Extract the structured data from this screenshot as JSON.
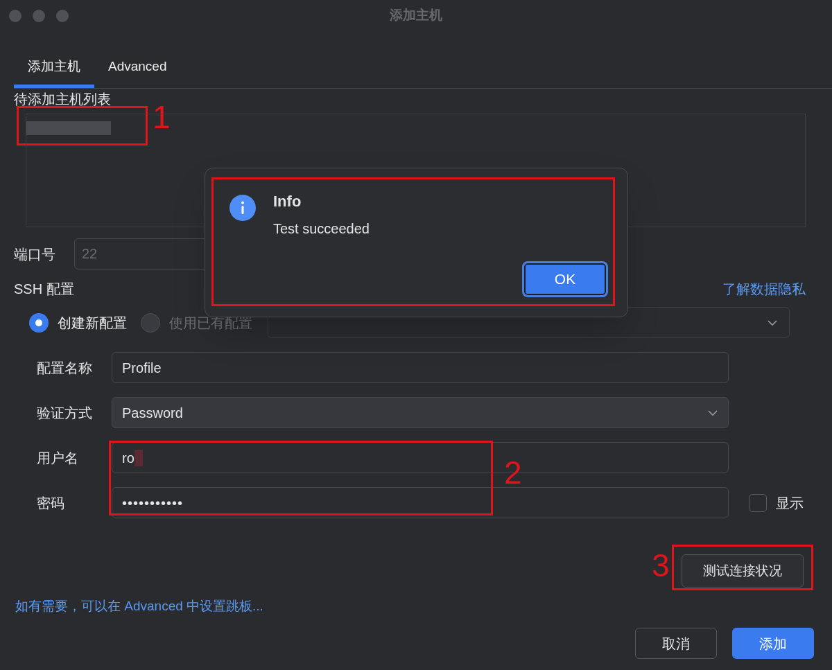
{
  "window": {
    "title": "添加主机"
  },
  "tabs": [
    {
      "label": "添加主机",
      "selected": true
    },
    {
      "label": "Advanced",
      "selected": false
    }
  ],
  "host_list": {
    "label": "待添加主机列表"
  },
  "port": {
    "label": "端口号",
    "placeholder": "22"
  },
  "ssh": {
    "label": "SSH 配置",
    "privacy_link": "了解数据隐私",
    "options": [
      {
        "label": "创建新配置",
        "selected": true
      },
      {
        "label": "使用已有配置",
        "selected": false
      }
    ]
  },
  "fields": [
    {
      "label": "配置名称",
      "value": "Profile",
      "kind": "text"
    },
    {
      "label": "验证方式",
      "value": "Password",
      "kind": "select"
    },
    {
      "label": "用户名",
      "value": "ro",
      "kind": "redacted"
    },
    {
      "label": "密码",
      "value": "•••••••••••",
      "kind": "password"
    }
  ],
  "show_password": {
    "label": "显示",
    "checked": false
  },
  "test_button": "测试连接状况",
  "hint_link": "如有需要，可以在 Advanced 中设置跳板...",
  "buttons": [
    {
      "label": "取消",
      "kind": "secondary"
    },
    {
      "label": "添加",
      "kind": "primary"
    }
  ],
  "dialog": {
    "title": "Info",
    "message": "Test succeeded",
    "button": "OK"
  },
  "annotations": [
    "1",
    "2",
    "3"
  ]
}
